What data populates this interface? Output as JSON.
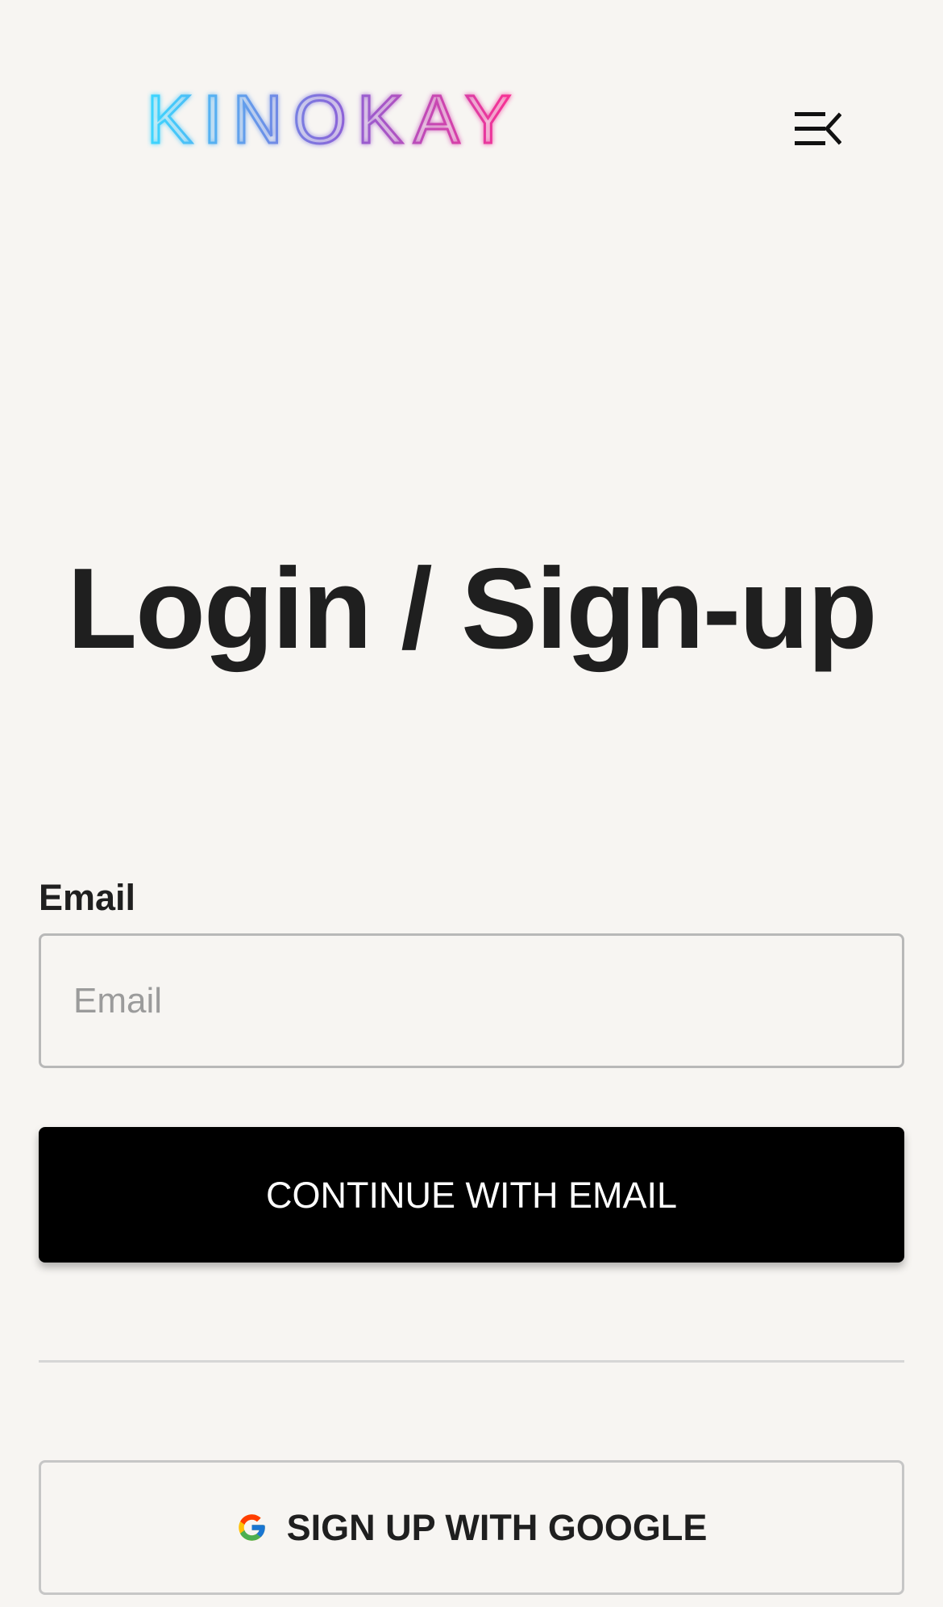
{
  "brand": {
    "name": "KINOKAY",
    "gradient_start": "#3ad8ff",
    "gradient_middle": "#8b63d8",
    "gradient_end": "#ff2d8f"
  },
  "header": {
    "menu_icon": "menu-collapse-icon"
  },
  "main": {
    "title": "Login / Sign-up"
  },
  "form": {
    "email_label": "Email",
    "email_placeholder": "Email",
    "email_value": "",
    "continue_label": "CONTINUE WITH EMAIL",
    "google_label": "SIGN UP WITH GOOGLE",
    "google_icon": "google-icon"
  },
  "colors": {
    "background": "#f7f5f2",
    "primary_button": "#000000",
    "text": "#1f1f1f",
    "input_border": "#b8b8b8"
  }
}
